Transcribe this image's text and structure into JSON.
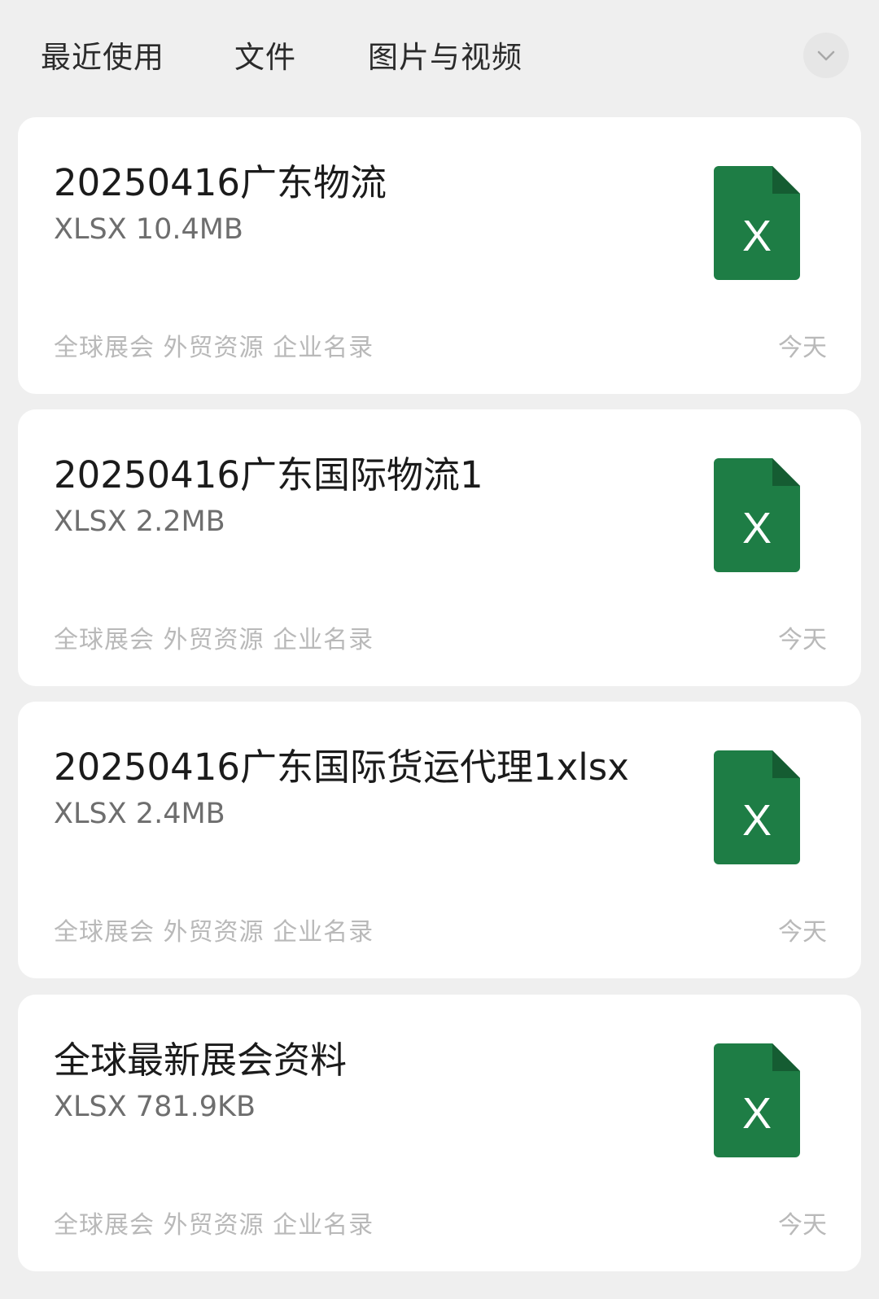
{
  "tabs": [
    {
      "label": "最近使用"
    },
    {
      "label": "文件"
    },
    {
      "label": "图片与视频"
    }
  ],
  "dropdown": {
    "icon": "chevron-down-icon"
  },
  "files": [
    {
      "name": "20250416广东物流",
      "meta": "XLSX 10.4MB",
      "tags": "全球展会 外贸资源 企业名录",
      "date": "今天",
      "icon": "excel-file-icon",
      "icon_letter": "X"
    },
    {
      "name": "20250416广东国际物流1",
      "meta": "XLSX 2.2MB",
      "tags": "全球展会 外贸资源 企业名录",
      "date": "今天",
      "icon": "excel-file-icon",
      "icon_letter": "X"
    },
    {
      "name": "20250416广东国际货运代理1xlsx",
      "meta": "XLSX 2.4MB",
      "tags": "全球展会 外贸资源 企业名录",
      "date": "今天",
      "icon": "excel-file-icon",
      "icon_letter": "X"
    },
    {
      "name": "全球最新展会资料",
      "meta": "XLSX 781.9KB",
      "tags": "全球展会 外贸资源 企业名录",
      "date": "今天",
      "icon": "excel-file-icon",
      "icon_letter": "X"
    }
  ],
  "colors": {
    "background": "#efefef",
    "card": "#ffffff",
    "excel_green": "#1e7d45",
    "excel_fold": "#155c32"
  }
}
